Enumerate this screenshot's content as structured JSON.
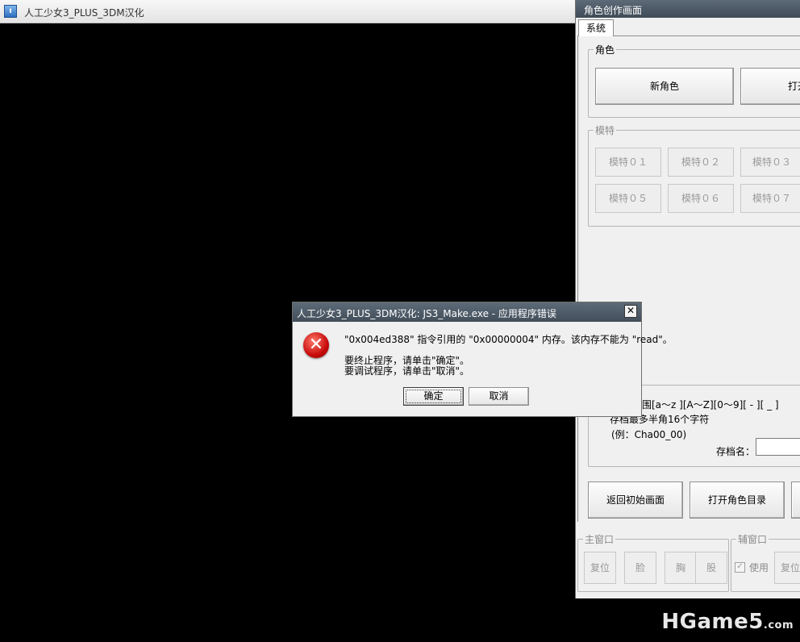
{
  "main_window": {
    "title": "人工少女3_PLUS_3DM汉化"
  },
  "panel": {
    "title": "角色创作画面",
    "tab": "系统",
    "role_group": {
      "title": "角色",
      "new_label": "新角色",
      "open_label": "打开"
    },
    "model_group": {
      "title": "模特",
      "buttons": [
        "模特０１",
        "模特０２",
        "模特０３",
        "模特０５",
        "模特０６",
        "模特０７"
      ]
    },
    "save_info": {
      "line1": "围[a～z ][A～Z][0～9][ - ][ _ ]",
      "line2": "存档最多半角16个字符",
      "line3": "(例：Cha00_00)",
      "save_name_label": "存档名："
    },
    "return_label": "返回初始画面",
    "open_dir_label": "打开角色目录",
    "main_window_group": {
      "title": "主窗口",
      "reset": "复位",
      "face": "脸",
      "chest": "胸",
      "hip": "股"
    },
    "sub_window_group": {
      "title": "辅窗口",
      "use": "使用",
      "reset": "复位"
    }
  },
  "dialog": {
    "title": "人工少女3_PLUS_3DM汉化: JS3_Make.exe - 应用程序错误",
    "close_glyph": "✕",
    "message1": "\"0x004ed388\" 指令引用的 \"0x00000004\" 内存。该内存不能为 \"read\"。",
    "message2": "要终止程序，请单击\"确定\"。",
    "message3": "要调试程序，请单击\"取消\"。",
    "ok_label": "确定",
    "cancel_label": "取消",
    "icon": "error-icon"
  },
  "watermark": {
    "brand": "HGame5",
    "suffix": ".com"
  }
}
